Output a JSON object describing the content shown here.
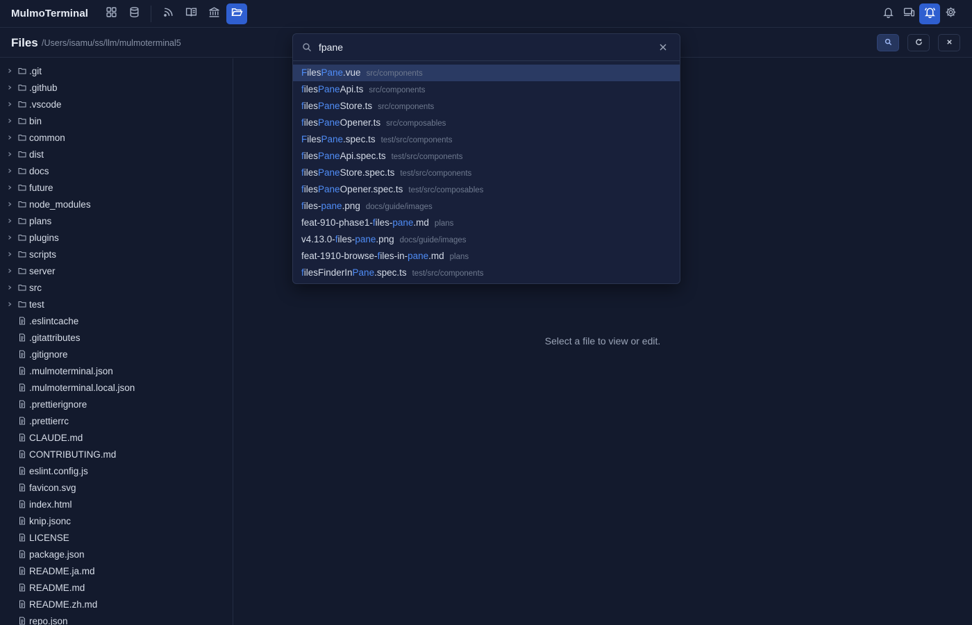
{
  "app": {
    "title": "MulmoTerminal"
  },
  "nav": {
    "left_icons": [
      "grid-icon",
      "database-icon",
      "rss-icon",
      "book-open-icon",
      "bank-icon",
      "folder-open-icon"
    ],
    "right_icons": [
      "bell-icon",
      "devices-icon",
      "bell-alert-icon",
      "gear-icon"
    ]
  },
  "header": {
    "title": "Files",
    "path": "/Users/isamu/ss/llm/mulmoterminal5",
    "buttons": [
      "search-icon",
      "refresh-icon",
      "close-icon"
    ]
  },
  "tree": {
    "folders": [
      ".git",
      ".github",
      ".vscode",
      "bin",
      "common",
      "dist",
      "docs",
      "future",
      "node_modules",
      "plans",
      "plugins",
      "scripts",
      "server",
      "src",
      "test"
    ],
    "files": [
      ".eslintcache",
      ".gitattributes",
      ".gitignore",
      ".mulmoterminal.json",
      ".mulmoterminal.local.json",
      ".prettierignore",
      ".prettierrc",
      "CLAUDE.md",
      "CONTRIBUTING.md",
      "eslint.config.js",
      "favicon.svg",
      "index.html",
      "knip.jsonc",
      "LICENSE",
      "package.json",
      "README.ja.md",
      "README.md",
      "README.zh.md",
      "repo.json"
    ]
  },
  "main": {
    "empty_text": "Select a file to view or edit."
  },
  "finder": {
    "query": "fpane",
    "selected_index": 0,
    "results": [
      {
        "parts": [
          [
            "F",
            true
          ],
          [
            "iles",
            false
          ],
          [
            "Pane",
            true
          ],
          [
            ".vue",
            false
          ]
        ],
        "dir": "src/components"
      },
      {
        "parts": [
          [
            "f",
            true
          ],
          [
            "iles",
            false
          ],
          [
            "Pane",
            true
          ],
          [
            "Api.ts",
            false
          ]
        ],
        "dir": "src/components"
      },
      {
        "parts": [
          [
            "f",
            true
          ],
          [
            "iles",
            false
          ],
          [
            "Pane",
            true
          ],
          [
            "Store.ts",
            false
          ]
        ],
        "dir": "src/components"
      },
      {
        "parts": [
          [
            "f",
            true
          ],
          [
            "iles",
            false
          ],
          [
            "Pane",
            true
          ],
          [
            "Opener.ts",
            false
          ]
        ],
        "dir": "src/composables"
      },
      {
        "parts": [
          [
            "F",
            true
          ],
          [
            "iles",
            false
          ],
          [
            "Pane",
            true
          ],
          [
            ".spec.ts",
            false
          ]
        ],
        "dir": "test/src/components"
      },
      {
        "parts": [
          [
            "f",
            true
          ],
          [
            "iles",
            false
          ],
          [
            "Pane",
            true
          ],
          [
            "Api.spec.ts",
            false
          ]
        ],
        "dir": "test/src/components"
      },
      {
        "parts": [
          [
            "f",
            true
          ],
          [
            "iles",
            false
          ],
          [
            "Pane",
            true
          ],
          [
            "Store.spec.ts",
            false
          ]
        ],
        "dir": "test/src/components"
      },
      {
        "parts": [
          [
            "f",
            true
          ],
          [
            "iles",
            false
          ],
          [
            "Pane",
            true
          ],
          [
            "Opener.spec.ts",
            false
          ]
        ],
        "dir": "test/src/composables"
      },
      {
        "parts": [
          [
            "f",
            true
          ],
          [
            "iles-",
            false
          ],
          [
            "pane",
            true
          ],
          [
            ".png",
            false
          ]
        ],
        "dir": "docs/guide/images"
      },
      {
        "parts": [
          [
            "feat-910-phase1-",
            false
          ],
          [
            "f",
            true
          ],
          [
            "iles-",
            false
          ],
          [
            "pane",
            true
          ],
          [
            ".md",
            false
          ]
        ],
        "dir": "plans"
      },
      {
        "parts": [
          [
            "v4.13.0-",
            false
          ],
          [
            "f",
            true
          ],
          [
            "iles-",
            false
          ],
          [
            "pane",
            true
          ],
          [
            ".png",
            false
          ]
        ],
        "dir": "docs/guide/images"
      },
      {
        "parts": [
          [
            "feat-1910-browse-",
            false
          ],
          [
            "f",
            true
          ],
          [
            "iles-in-",
            false
          ],
          [
            "pane",
            true
          ],
          [
            ".md",
            false
          ]
        ],
        "dir": "plans"
      },
      {
        "parts": [
          [
            "f",
            true
          ],
          [
            "ilesFinderIn",
            false
          ],
          [
            "Pane",
            true
          ],
          [
            ".spec.ts",
            false
          ]
        ],
        "dir": "test/src/components"
      }
    ]
  },
  "colors": {
    "accent": "#2f5fd0",
    "highlight": "#4f8cf5",
    "background": "#131a2d"
  }
}
